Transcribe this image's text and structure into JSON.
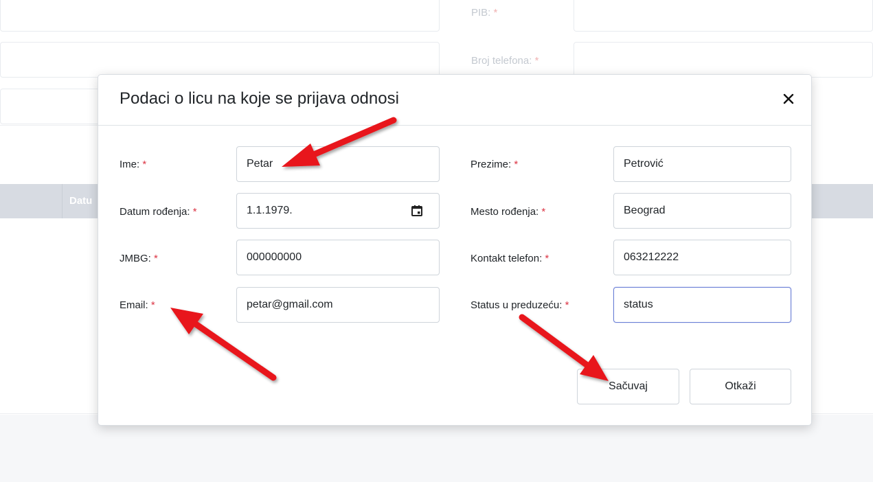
{
  "background": {
    "pib_label": "PIB:",
    "phone_label": "Broj telefona:",
    "required_mark": "*",
    "table_col_partial": "Datu"
  },
  "modal": {
    "title": "Podaci o licu na koje se prijava odnosi",
    "close_label": "✕",
    "fields": {
      "ime": {
        "label": "Ime:",
        "value": "Petar"
      },
      "prezime": {
        "label": "Prezime:",
        "value": "Petrović"
      },
      "datum": {
        "label": "Datum rođenja:",
        "value": "1.1.1979."
      },
      "mesto": {
        "label": "Mesto rođenja:",
        "value": "Beograd"
      },
      "jmbg": {
        "label": "JMBG:",
        "value": "000000000"
      },
      "telefon": {
        "label": "Kontakt telefon:",
        "value": "063212222"
      },
      "email": {
        "label": "Email:",
        "value": "petar@gmail.com"
      },
      "status": {
        "label": "Status u preduzeću:",
        "value": "status"
      }
    },
    "required_mark": "*",
    "buttons": {
      "save": "Sačuvaj",
      "cancel": "Otkaži"
    }
  },
  "colors": {
    "required": "#dc3545",
    "focus_border": "#6a7fd6",
    "arrow": "#e8141a"
  },
  "icons": [
    "close-icon",
    "calendar-icon",
    "annotation-arrow"
  ]
}
